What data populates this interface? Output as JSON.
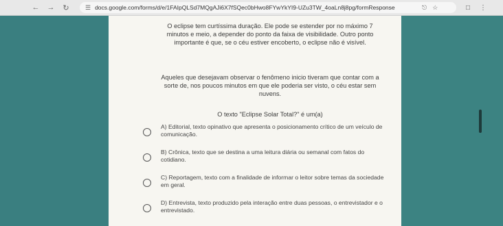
{
  "browser": {
    "url": "docs.google.com/forms/d/e/1FAIpQLSd7MQgAJi6X7fSQec0bHwo8FYwYkYI9-UZu3TW_4oaLn8j8pg/formResponse",
    "back_icon": "back-arrow-icon",
    "forward_icon": "forward-arrow-icon",
    "reload_icon": "reload-icon"
  },
  "form": {
    "paragraph1": "O eclipse tem curtíssima duração. Ele pode se estender por no máximo 7 minutos e meio, a depender do ponto da faixa de visibilidade. Outro ponto importante é que, se o céu estiver encoberto, o eclipse não é visível.",
    "paragraph2": "Aqueles que desejavam observar o fenômeno inicio tiveram que contar com a sorte de, nos poucos minutos em que ele poderia ser visto, o céu estar sem nuvens.",
    "question": "O texto \"Eclipse Solar Total?\" é um(a)",
    "options": [
      {
        "label": "A) Editorial, texto opinativo que apresenta o posicionamento crítico de um veículo de comunicação."
      },
      {
        "label": "B) Crônica, texto que se destina a uma leitura diária ou semanal com fatos do cotidiano."
      },
      {
        "label": "C) Reportagem, texto com a finalidade de informar o leitor sobre temas da sociedade em geral."
      },
      {
        "label": "D) Entrevista, texto produzido pela interação entre duas pessoas, o entrevistador e o entrevistado."
      }
    ]
  }
}
